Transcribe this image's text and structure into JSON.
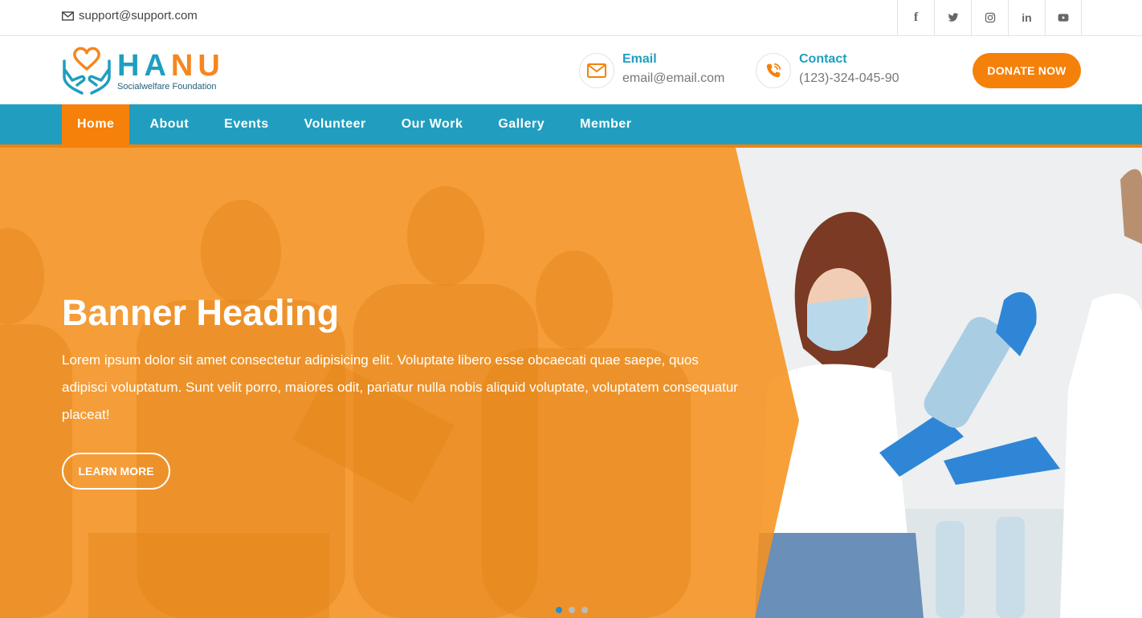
{
  "topbar": {
    "email": "support@support.com",
    "social": [
      {
        "icon": "facebook-icon",
        "glyph": "f"
      },
      {
        "icon": "twitter-icon",
        "glyph": ""
      },
      {
        "icon": "instagram-icon",
        "glyph": ""
      },
      {
        "icon": "linkedin-icon",
        "glyph": "in"
      },
      {
        "icon": "youtube-icon",
        "glyph": ""
      }
    ]
  },
  "header": {
    "brand_part1": "HA",
    "brand_part2": "NU",
    "brand_sub": "Socialwelfare Foundation",
    "email_label": "Email",
    "email_value": "email@email.com",
    "contact_label": "Contact",
    "contact_value": "(123)-324-045-90",
    "donate_label": "DONATE NOW"
  },
  "nav": {
    "items": [
      {
        "label": "Home",
        "active": true
      },
      {
        "label": "About"
      },
      {
        "label": "Events"
      },
      {
        "label": "Volunteer"
      },
      {
        "label": "Our Work"
      },
      {
        "label": "Gallery"
      },
      {
        "label": "Member"
      }
    ]
  },
  "hero": {
    "heading": "Banner Heading",
    "text": "Lorem ipsum dolor sit amet consectetur adipisicing elit. Voluptate libero esse obcaecati quae saepe, quos adipisci voluptatum. Sunt velit porro, maiores odit, pariatur nulla nobis aliquid voluptate, voluptatem consequatur placeat!",
    "button": "LEARN MORE",
    "slides": 3,
    "active_slide": 1
  },
  "colors": {
    "primary_blue": "#219ebf",
    "accent_orange": "#f5810a"
  }
}
